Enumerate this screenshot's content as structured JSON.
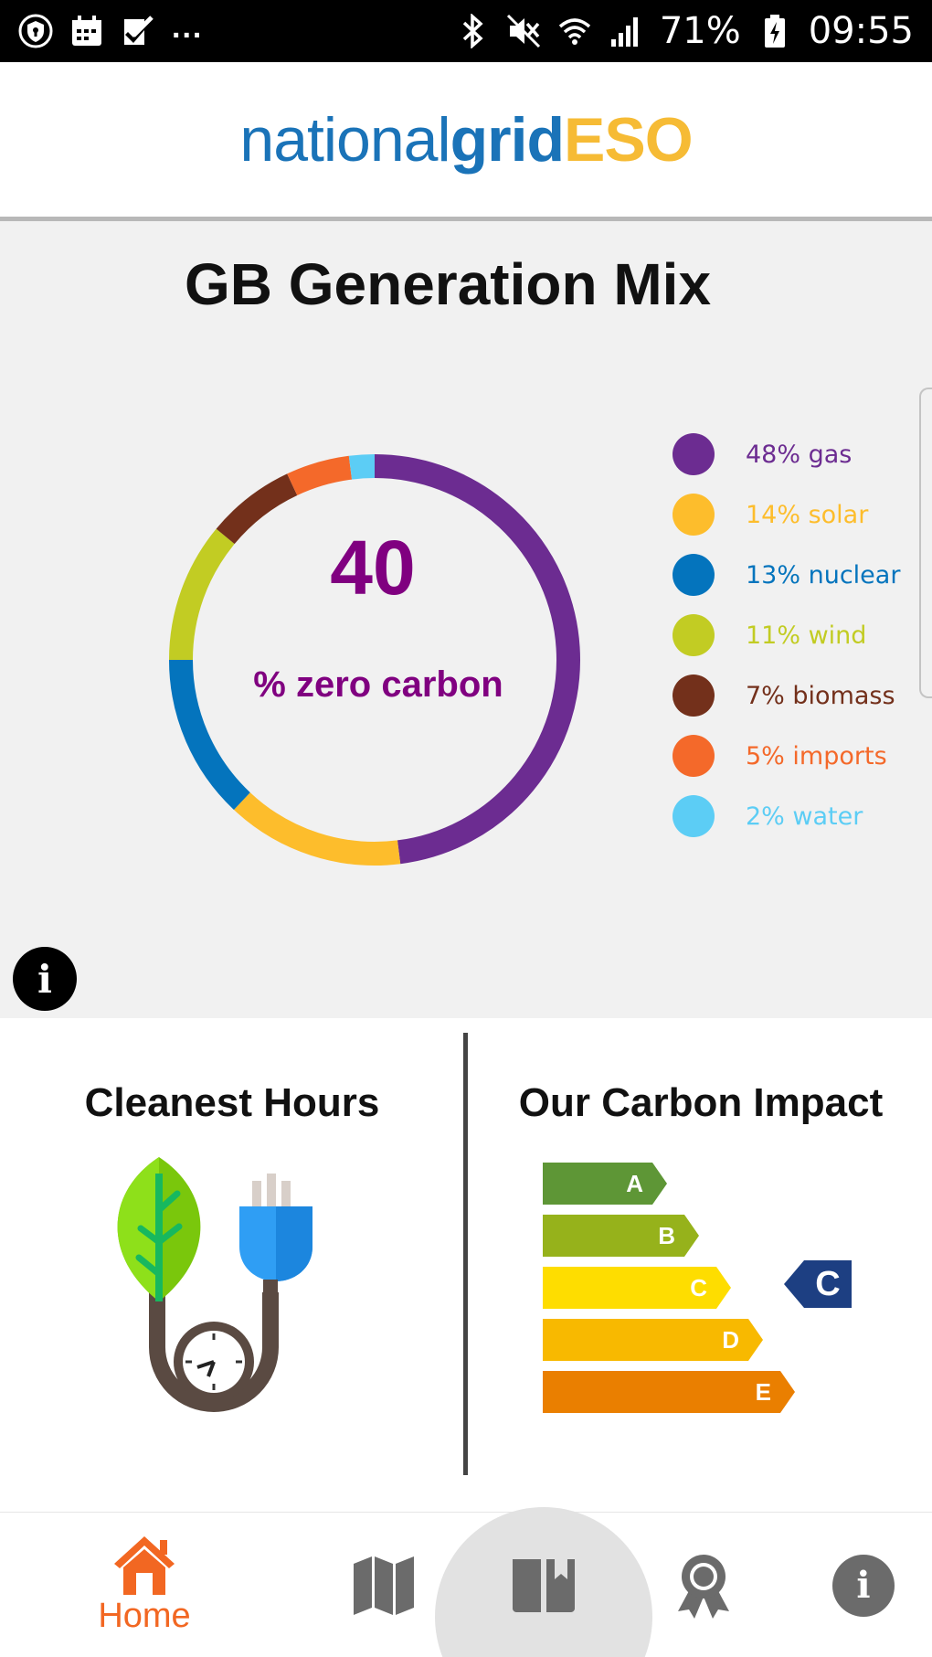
{
  "status_bar": {
    "left_icons": [
      "shield-icon",
      "calendar-icon",
      "check-list-icon"
    ],
    "overflow": "...",
    "right_icons": [
      "bluetooth-icon",
      "mute-icon",
      "wifi-icon",
      "signal-icon"
    ],
    "battery": "71%",
    "time": "09:55"
  },
  "header": {
    "logo_part1": "national",
    "logo_part2": "grid",
    "logo_part3": "ESO"
  },
  "mix": {
    "title": "GB Generation Mix",
    "center_value": "40",
    "center_label": "% zero carbon",
    "segments": [
      {
        "label": "48% gas",
        "value": 48,
        "color": "#6c2c91"
      },
      {
        "label": "14% solar",
        "value": 14,
        "color": "#fdbd2c"
      },
      {
        "label": "13% nuclear",
        "value": 13,
        "color": "#0474bd"
      },
      {
        "label": "11% wind",
        "value": 11,
        "color": "#c2cc23"
      },
      {
        "label": "7% biomass",
        "value": 7,
        "color": "#73301b"
      },
      {
        "label": "5% imports",
        "value": 5,
        "color": "#f4692a"
      },
      {
        "label": "2% water",
        "value": 2,
        "color": "#5ccdf5"
      }
    ],
    "center_color": "#800080"
  },
  "cards": {
    "cleanest_title": "Cleanest Hours",
    "carbon_title": "Our Carbon Impact",
    "rating_bands": [
      {
        "letter": "A",
        "color": "#5e9636"
      },
      {
        "letter": "B",
        "color": "#96b21b"
      },
      {
        "letter": "C",
        "color": "#fedd00"
      },
      {
        "letter": "D",
        "color": "#f8b900"
      },
      {
        "letter": "E",
        "color": "#ea7f00"
      }
    ],
    "current_rating": "C",
    "current_rating_color": "#1d3f82"
  },
  "nav": {
    "home_label": "Home",
    "active_color": "#f26722",
    "inactive_color": "#6b6b6b",
    "items": [
      "home-icon",
      "map-icon",
      "book-icon",
      "award-icon",
      "info-icon"
    ]
  }
}
